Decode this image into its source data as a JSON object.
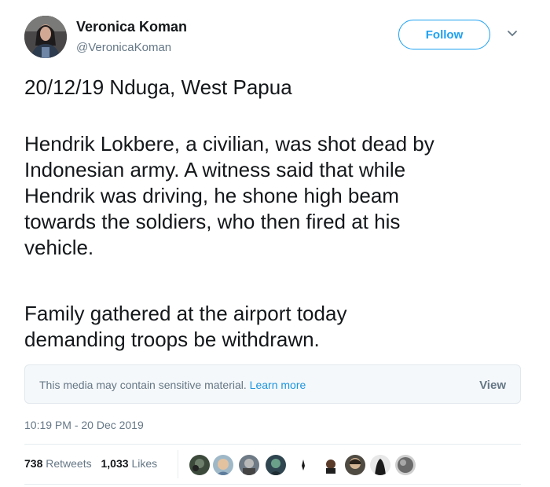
{
  "user": {
    "display_name": "Veronica Koman",
    "handle": "@VeronicaKoman",
    "avatar_icon": "user-avatar"
  },
  "follow_label": "Follow",
  "tweet": {
    "line1": "20/12/19 Nduga, West Papua",
    "para2": "Hendrik Lokbere, a civilian, was shot dead by\nIndonesian army. A witness said that while\nHendrik was driving, he shone high beam\ntowards the soldiers, who then fired at his\nvehicle.",
    "para3": "Family gathered at the airport today\ndemanding troops be withdrawn."
  },
  "sensitive": {
    "message": "This media may contain sensitive material.",
    "learn_more": "Learn more",
    "view": "View"
  },
  "timestamp": "10:19 PM - 20 Dec 2019",
  "stats": {
    "retweets_count": "738",
    "retweets_label": "Retweets",
    "likes_count": "1,033",
    "likes_label": "Likes"
  },
  "colors": {
    "accent": "#1da1f2",
    "link": "#1b95e0",
    "muted": "#657786"
  }
}
